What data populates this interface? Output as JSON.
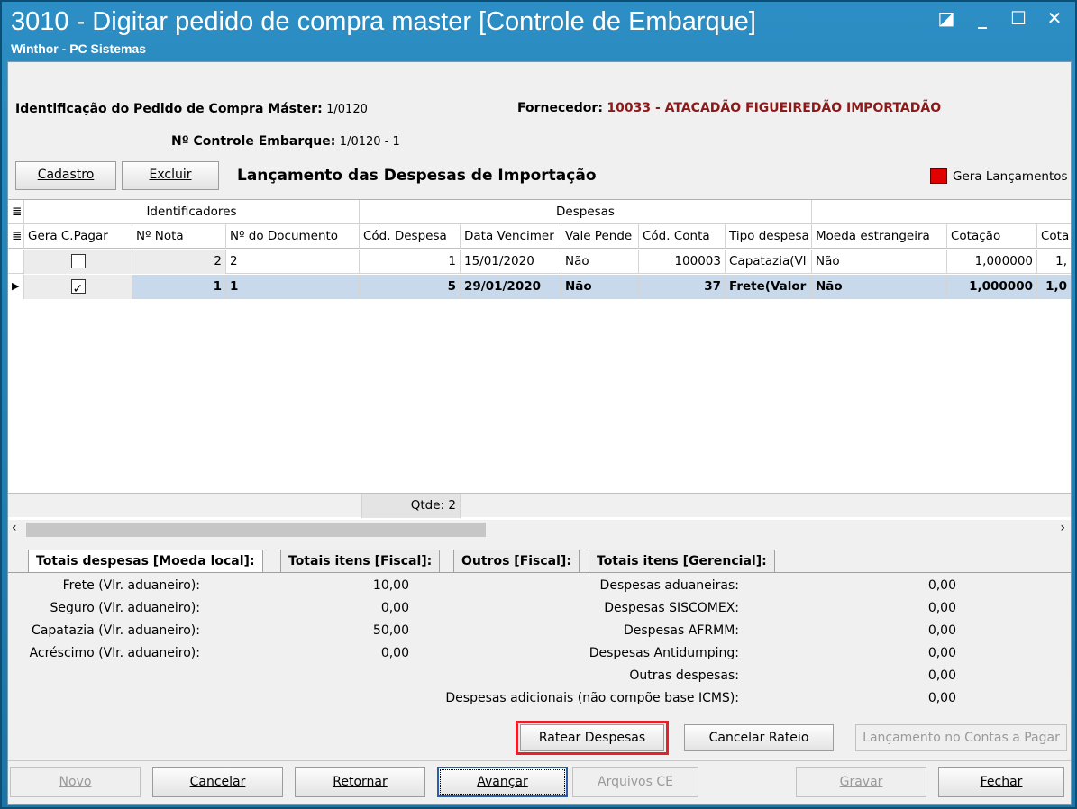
{
  "window": {
    "title": "3010 - Digitar pedido de compra master [Controle de Embarque]",
    "subtitle": "Winthor - PC Sistemas",
    "buttons": [
      "◪",
      "_",
      "☐",
      "✕"
    ]
  },
  "header": {
    "pedido_label": "Identificação do Pedido de Compra Máster:",
    "pedido_value": "1/0120",
    "fornecedor_label": "Fornecedor:",
    "fornecedor_value": "10033 - ATACADÃO FIGUEIREDÃO IMPORTADÃO",
    "controle_label": "Nº Controle Embarque:",
    "controle_value": "1/0120 - 1",
    "section_title": "Lançamento das Despesas de Importação",
    "gera_lancamentos": "Gera Lançamentos"
  },
  "actions": {
    "cadastro": "Cadastro",
    "excluir": "Excluir"
  },
  "grid": {
    "group_identificadores": "Identificadores",
    "group_despesas": "Despesas",
    "columns": [
      "Gera C.Pagar",
      "Nº Nota",
      "Nº do Documento",
      "Cód. Despesa",
      "Data Vencimer",
      "Vale Pende",
      "Cód. Conta",
      "Tipo despesa",
      "Moeda estrangeira",
      "Cotação",
      "Cota"
    ],
    "rows": [
      {
        "gera": false,
        "nota": "2",
        "doc": "2",
        "cod_despesa": "1",
        "data": "15/01/2020",
        "vale": "Não",
        "cod_conta": "100003",
        "tipo": "Capatazia(Vl",
        "moeda": "Não",
        "cotacao": "1,000000",
        "cota": "1,"
      },
      {
        "gera": true,
        "nota": "1",
        "doc": "1",
        "cod_despesa": "5",
        "data": "29/01/2020",
        "vale": "Não",
        "cod_conta": "37",
        "tipo": "Frete(Valor",
        "moeda": "Não",
        "cotacao": "1,000000",
        "cota": "1,0"
      }
    ],
    "qtde": "Qtde: 2"
  },
  "tabs": [
    "Totais despesas [Moeda local]:",
    "Totais itens [Fiscal]:",
    "Outros [Fiscal]:",
    "Totais itens [Gerencial]:"
  ],
  "totais_left": [
    {
      "label": "Frete (Vlr. aduaneiro):",
      "value": "10,00"
    },
    {
      "label": "Seguro (Vlr. aduaneiro):",
      "value": "0,00"
    },
    {
      "label": "Capatazia (Vlr. aduaneiro):",
      "value": "50,00"
    },
    {
      "label": "Acréscimo (Vlr. aduaneiro):",
      "value": "0,00"
    }
  ],
  "totais_right": [
    {
      "label": "Despesas aduaneiras:",
      "value": "0,00"
    },
    {
      "label": "Despesas SISCOMEX:",
      "value": "0,00"
    },
    {
      "label": "Despesas AFRMM:",
      "value": "0,00"
    },
    {
      "label": "Despesas Antidumping:",
      "value": "0,00"
    },
    {
      "label": "Outras despesas:",
      "value": "0,00"
    },
    {
      "label": "Despesas adicionais (não compõe base ICMS):",
      "value": "0,00"
    }
  ],
  "rateio": {
    "ratear": "Ratear Despesas",
    "cancelar": "Cancelar Rateio",
    "lancamento": "Lançamento no Contas a Pagar"
  },
  "bottom": {
    "novo": "Novo",
    "cancelar": "Cancelar",
    "retornar": "Retornar",
    "avancar": "Avançar",
    "arquivos": "Arquivos CE",
    "gravar": "Gravar",
    "fechar": "Fechar"
  },
  "colors": {
    "title_bg": "#1d74a6",
    "fornecedor": "#8b1a1a",
    "highlight": "#e8202a",
    "selected_row": "#c7d9ea"
  }
}
